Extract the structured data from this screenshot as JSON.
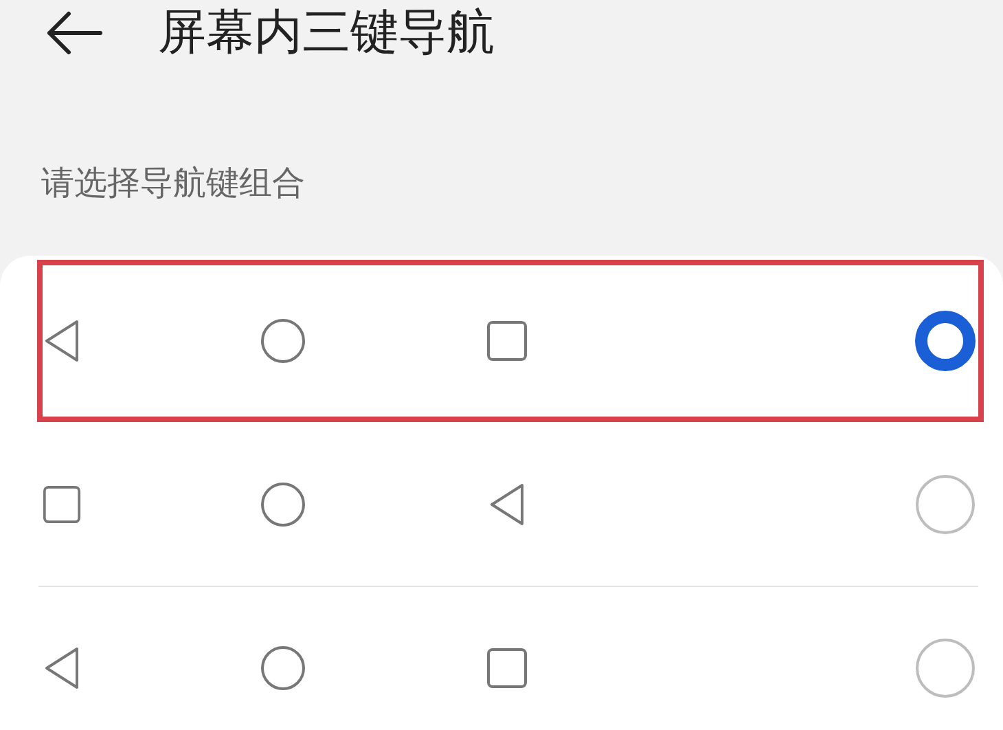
{
  "header": {
    "title": "屏幕内三键导航"
  },
  "section": {
    "label": "请选择导航键组合"
  },
  "options": [
    {
      "keys": [
        {
          "kind": "back"
        },
        {
          "kind": "home"
        },
        {
          "kind": "recent"
        }
      ],
      "selected": true,
      "highlighted": true
    },
    {
      "keys": [
        {
          "kind": "recent"
        },
        {
          "kind": "home"
        },
        {
          "kind": "back"
        }
      ],
      "selected": false,
      "highlighted": false
    },
    {
      "keys": [
        {
          "kind": "back"
        },
        {
          "kind": "home"
        },
        {
          "kind": "recent"
        }
      ],
      "selected": false,
      "highlighted": false
    }
  ]
}
